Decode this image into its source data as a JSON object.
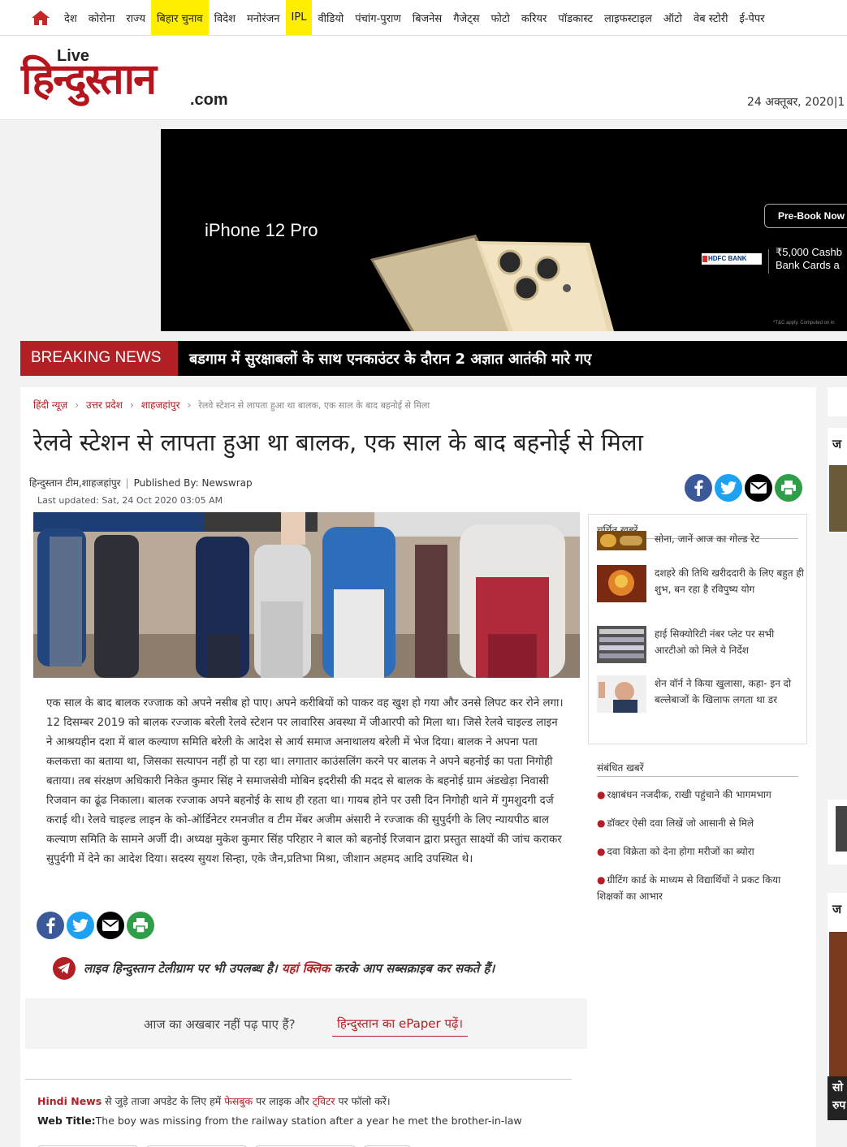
{
  "nav": {
    "items": [
      "देश",
      "कोरोना",
      "राज्य",
      "बिहार चुनाव",
      "विदेश",
      "मनोरंजन",
      "IPL",
      "वीडियो",
      "पंचांग-पुराण",
      "बिजनेस",
      "गैजेट्स",
      "फोटो",
      "करियर",
      "पॉडकास्ट",
      "लाइफस्टाइल",
      "ऑटो",
      "वेब स्टोरी",
      "ई-पेपर"
    ],
    "highlighted": [
      "बिहार चुनाव",
      "IPL"
    ]
  },
  "header": {
    "logo_live": "Live",
    "logo_main": "हिन्दुस्तान",
    "logo_com": ".com",
    "date": "24 अक्तूबर, 2020|1"
  },
  "ad": {
    "brand": "iPhone 12 Pro",
    "cta": "Pre-Book Now",
    "bank": "HDFC BANK",
    "cashback_line1": "₹5,000 Cashb",
    "cashback_line2": "Bank Cards a",
    "terms": "*T&C apply. Computed on in"
  },
  "breaking": {
    "label": "BREAKING NEWS",
    "text": "बडगाम में सुरक्षाबलों के साथ एनकाउंटर के दौरान 2 अज्ञात आतंकी मारे गए"
  },
  "breadcrumb": [
    "हिंदी न्यूज़",
    "उत्तर प्रदेश",
    "शाहजहांपुर",
    "रेलवे स्टेशन से लापता हुआ था बालक, एक साल के बाद बहनोई से मिला"
  ],
  "article": {
    "title": "रेलवे स्टेशन से लापता हुआ था बालक, एक साल के बाद बहनोई से मिला",
    "author": "हिन्दुस्तान टीम,शाहजहांपुर",
    "published_by": "Published By: Newswrap",
    "last_updated": "Last updated:  Sat, 24 Oct 2020 03:05 AM",
    "body": "एक साल के बाद बालक रज्जाक को अपने नसीब हो पाए। अपने करीबियों को पाकर वह खुश हो गया और उनसे लिपट कर रोने लगा। 12 दिसम्बर 2019 को बालक रज्जाक बरेली रेलवे स्टेशन पर लावारिस अवस्था में जीआरपी को मिला था। जिसे रेलवे चाइल्ड लाइन ने आश्रयहीन दशा में बाल कल्याण समिति बरेली के आदेश से आर्य समाज अनाथालय बरेली में भेज दिया। बालक ने अपना पता कलकत्ता का बताया था, जिसका सत्यापन नहीं हो पा रहा था। लगातार काउंसलिंग करने पर बालक ने अपने बहनोई का पता निगोही बताया। तब संरक्षण अधिकारी निकेत कुमार सिंह ने समाजसेवी मोबिन इदरीसी की मदद से बालक के बहनोई ग्राम अंडखेड़ा निवासी रिजवान का ढूंढ निकाला। बालक रज्जाक अपने बहनोई के साथ ही रहता था। गायब होने पर उसी दिन निगोही थाने में गुमशुदगी दर्ज कराई थी। रेलवे चाइल्ड लाइन के को-ऑर्डिनेटर रमनजीत व टीम मेंबर अजीम अंसारी ने रज्जाक की सुपुर्दगी के लिए न्यायपीठ बाल कल्याण समिति के सामने अर्जी दी। अध्यक्ष मुकेश कुमार सिंह परिहार ने बाल को बहनोई रिजवान द्वारा प्रस्तुत साक्ष्यों की जांच कराकर सुपुर्दगी में देने का आदेश दिया। सदस्य सुयश सिन्हा, एके जैन,प्रतिभा मिश्रा, जीशान अहमद आदि उपस्थित थे।"
  },
  "telegram": {
    "part1": "लाइव हिन्दुस्तान टेलीग्राम पर भी उपलब्ध है।",
    "link": "यहां क्लिक",
    "part2": "करके आप सब्सक्राइब कर सकते हैं।"
  },
  "epaper": {
    "question": "आज का अखबार नहीं पढ़ पाए हैं?",
    "link": "हिन्दुस्तान का ePaper पढ़ें।"
  },
  "follow": {
    "hindi_news": "Hindi News",
    "t1": "से जुड़े ताजा अपडेट के लिए हमें",
    "facebook": "फेसबुक",
    "t2": "पर लाइक और",
    "twitter": "ट्विटर",
    "t3": "पर फॉलो करें।"
  },
  "web_title": {
    "label": "Web Title:",
    "text": "The boy was missing from the railway station after a year he met the brother-in-law"
  },
  "trending": {
    "title": "चर्चित खबरें",
    "items": [
      "सोना, जानें आज का गोल्ड रेट",
      "दशहरे की तिथि खरीददारी के लिए बहुत ही शुभ, बन रहा है रविपुष्य योग",
      "हाई सिक्योरिटी नंबर प्लेट पर सभी आरटीओ को मिले ये निर्देश",
      "शेन वॉर्न ने किया खुलासा, कहा- इन दो बल्लेबाजों के खिलाफ लगता था डर"
    ]
  },
  "related": {
    "title": "संबंधित खबरें",
    "items": [
      "रक्षाबंधन नजदीक, राखी पहुंचाने की भागमभाग",
      "डॉक्टर ऐसी दवा लिखें जो आसानी से मिले",
      "दवा विक्रेता को देना होगा मरीजों का ब्योरा",
      "ग्रीटिंग कार्ड के माध्यम से विद्यार्थियों ने प्रकट किया शिक्षकों का आभार"
    ]
  },
  "right_sliver": {
    "h1": "ज",
    "h2": "ज",
    "h3": "सो",
    "h4": "रुप"
  }
}
